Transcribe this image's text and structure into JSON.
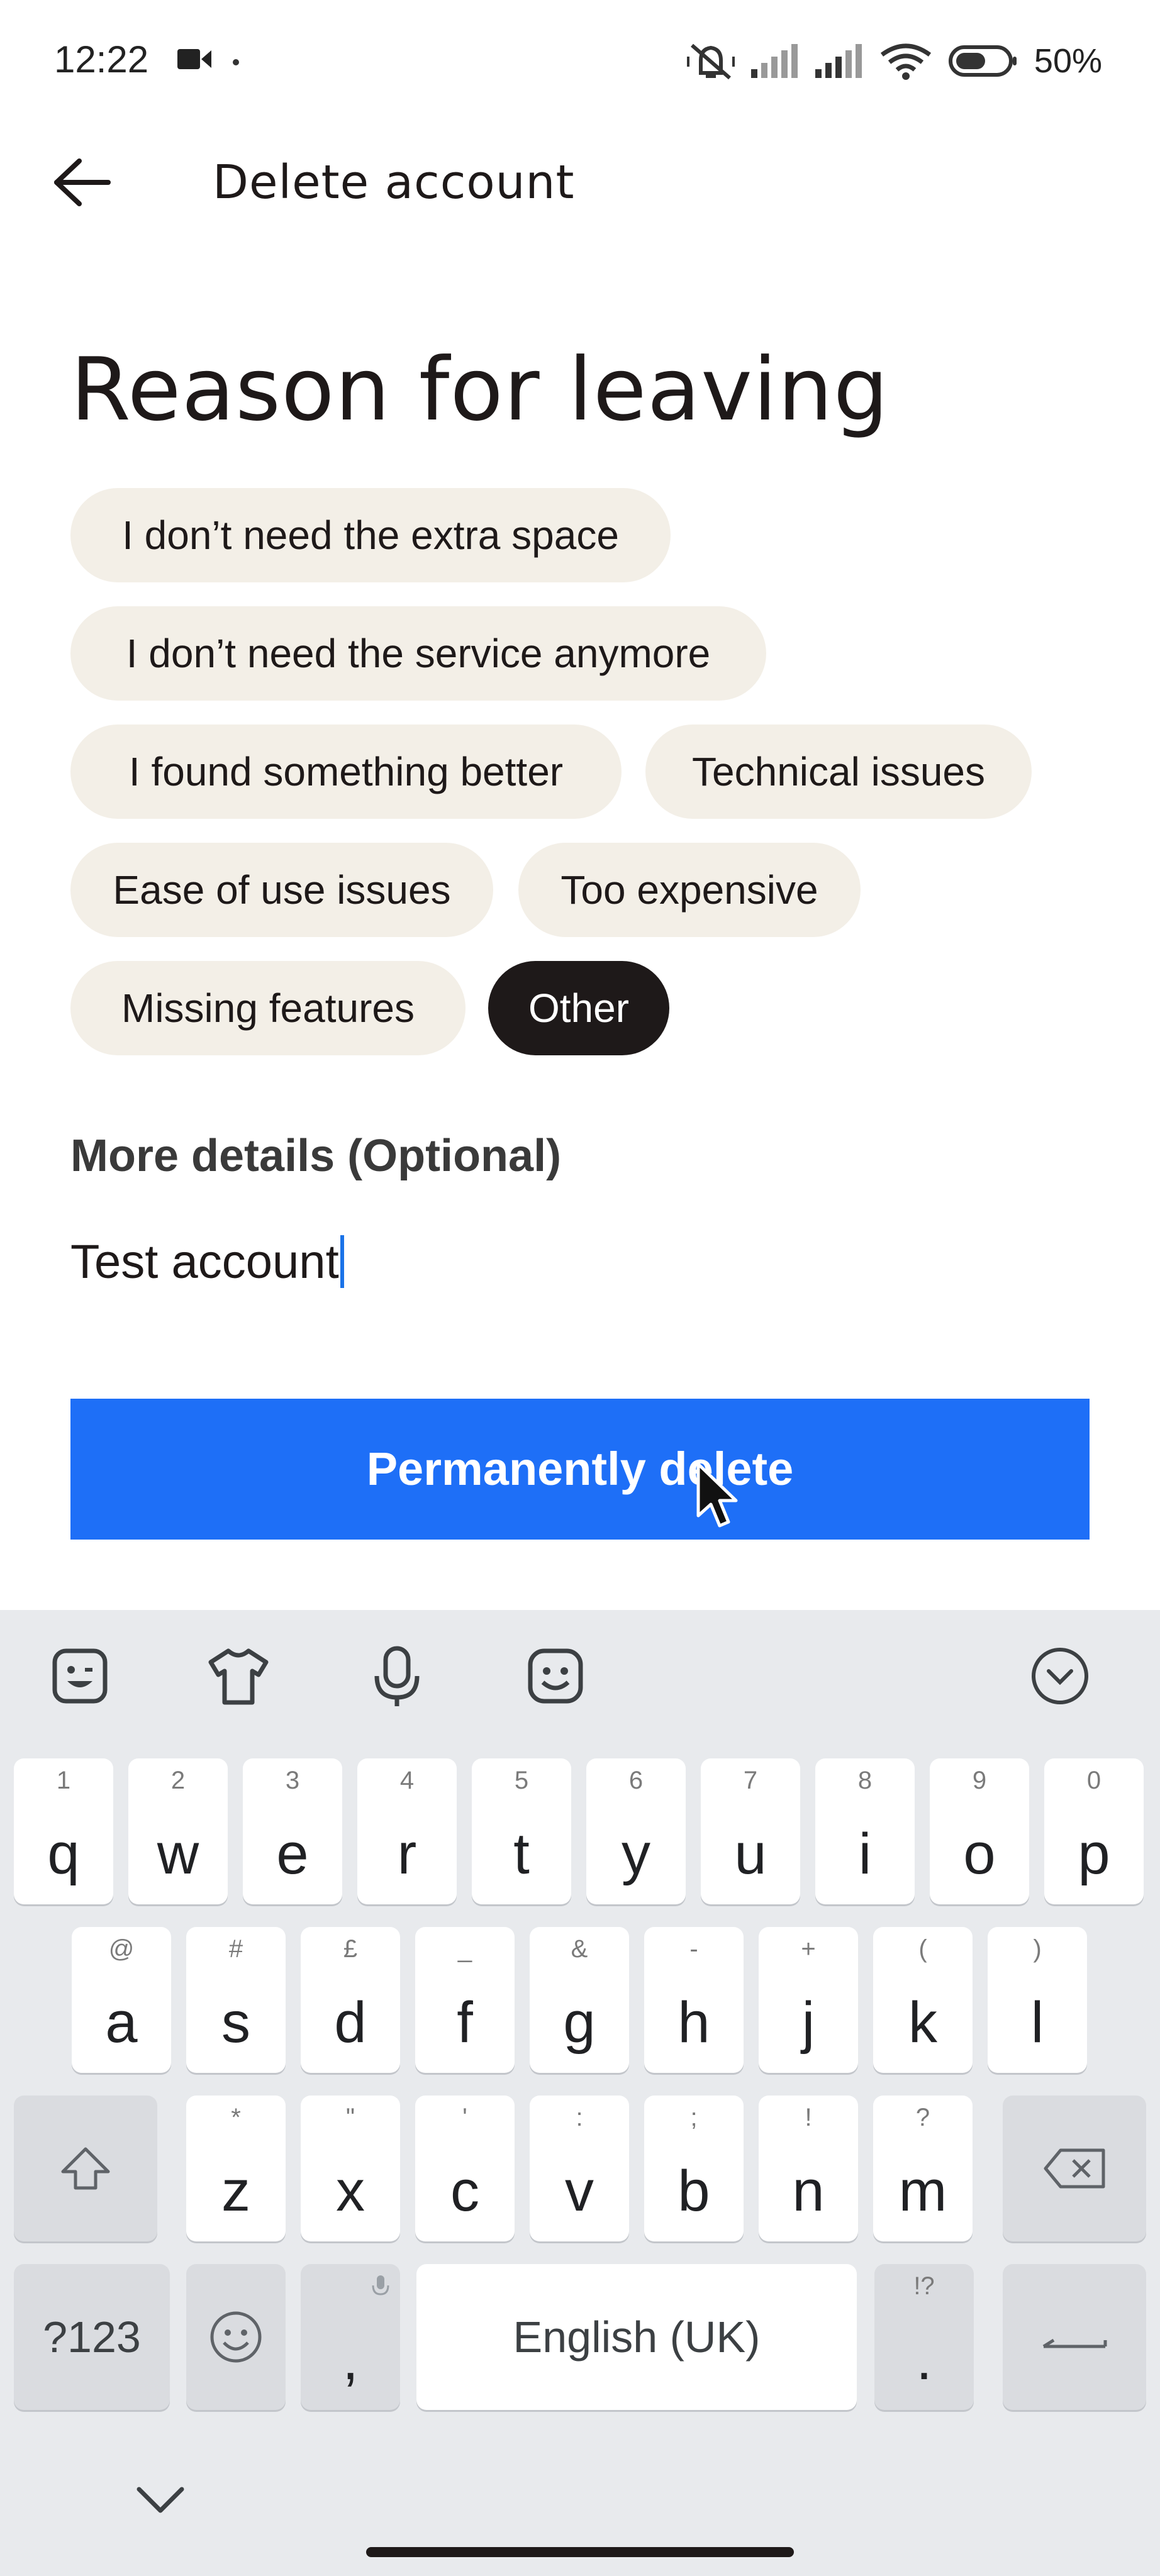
{
  "status_bar": {
    "time": "12:22",
    "battery_text": "50%"
  },
  "header": {
    "title": "Delete account"
  },
  "heading": "Reason for leaving",
  "reasons": [
    {
      "label": "I don’t need the extra space",
      "selected": false
    },
    {
      "label": "I don’t need the service anymore",
      "selected": false
    },
    {
      "label": "I found something better",
      "selected": false
    },
    {
      "label": "Technical issues",
      "selected": false
    },
    {
      "label": "Ease of use issues",
      "selected": false
    },
    {
      "label": "Too expensive",
      "selected": false
    },
    {
      "label": "Missing features",
      "selected": false
    },
    {
      "label": "Other",
      "selected": true
    }
  ],
  "details": {
    "label": "More details (Optional)",
    "value": "Test account"
  },
  "primary_button": "Permanently delete",
  "colors": {
    "accent": "#1e6ff7",
    "chip_bg": "#f3efe7",
    "chip_selected_bg": "#1e1919"
  },
  "keyboard": {
    "toolbar_icons": [
      "sticker-icon",
      "theme-icon",
      "microphone-icon",
      "emoji-icon",
      "collapse-icon"
    ],
    "row1": [
      {
        "k": "q",
        "s": "1"
      },
      {
        "k": "w",
        "s": "2"
      },
      {
        "k": "e",
        "s": "3"
      },
      {
        "k": "r",
        "s": "4"
      },
      {
        "k": "t",
        "s": "5"
      },
      {
        "k": "y",
        "s": "6"
      },
      {
        "k": "u",
        "s": "7"
      },
      {
        "k": "i",
        "s": "8"
      },
      {
        "k": "o",
        "s": "9"
      },
      {
        "k": "p",
        "s": "0"
      }
    ],
    "row2": [
      {
        "k": "a",
        "s": "@"
      },
      {
        "k": "s",
        "s": "#"
      },
      {
        "k": "d",
        "s": "£"
      },
      {
        "k": "f",
        "s": "_"
      },
      {
        "k": "g",
        "s": "&"
      },
      {
        "k": "h",
        "s": "-"
      },
      {
        "k": "j",
        "s": "+"
      },
      {
        "k": "k",
        "s": "("
      },
      {
        "k": "l",
        "s": ")"
      }
    ],
    "row3": [
      {
        "k": "z",
        "s": "*"
      },
      {
        "k": "x",
        "s": "\""
      },
      {
        "k": "c",
        "s": "'"
      },
      {
        "k": "v",
        "s": ":"
      },
      {
        "k": "b",
        "s": ";"
      },
      {
        "k": "n",
        "s": "!"
      },
      {
        "k": "m",
        "s": "?"
      }
    ],
    "symbols_label": "?123",
    "comma": ",",
    "space_label": "English (UK)",
    "period": ".",
    "period_sub": "!?"
  }
}
